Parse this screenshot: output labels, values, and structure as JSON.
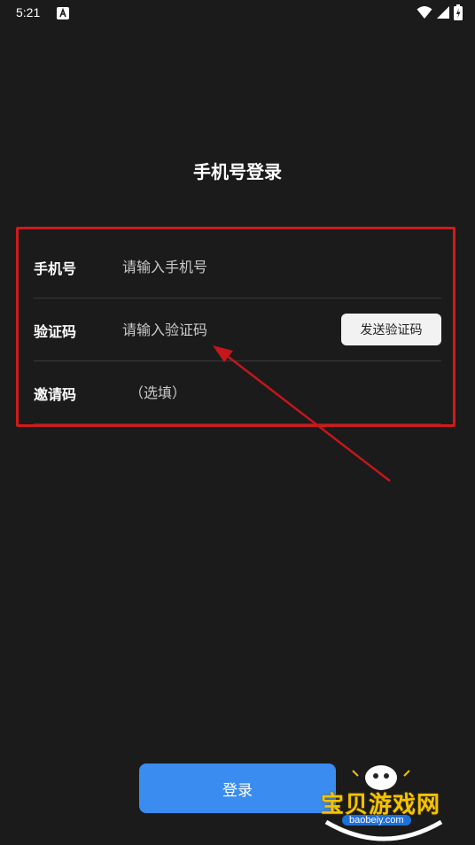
{
  "status_bar": {
    "time": "5:21"
  },
  "page": {
    "title": "手机号登录"
  },
  "form": {
    "phone": {
      "label": "手机号",
      "placeholder": "请输入手机号"
    },
    "code": {
      "label": "验证码",
      "placeholder": "请输入验证码",
      "send_button": "发送验证码"
    },
    "invite": {
      "label": "邀请码",
      "placeholder": "（选填）"
    }
  },
  "login_button": "登录",
  "watermark": {
    "name": "宝贝游戏网",
    "url": "baobeiy.com"
  },
  "colors": {
    "background": "#1b1b1b",
    "accent": "#3a8cf0",
    "annotation": "#d11a1a"
  }
}
